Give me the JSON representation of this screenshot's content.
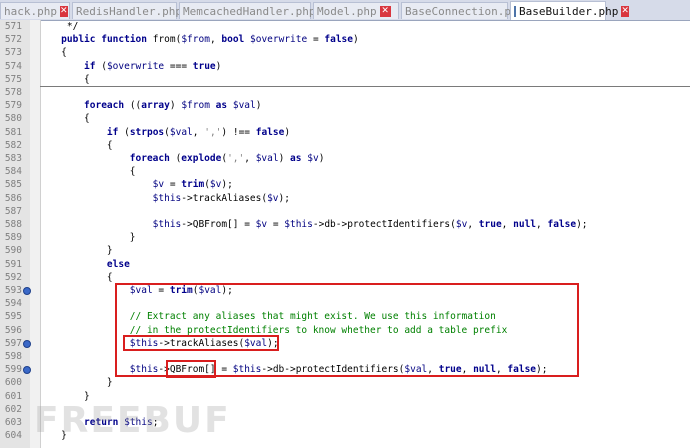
{
  "tabs": [
    {
      "label": "hack.php",
      "active": false
    },
    {
      "label": "RedisHandler.php",
      "active": false
    },
    {
      "label": "MemcachedHandler.php",
      "active": false
    },
    {
      "label": "Model.php",
      "active": false
    },
    {
      "label": "BaseConnection.php",
      "active": false
    },
    {
      "label": "BaseBuilder.php",
      "active": true
    }
  ],
  "lines": [
    {
      "num": "571",
      "code": "    */"
    },
    {
      "num": "572",
      "code": "   public function from($from, bool $overwrite = false)"
    },
    {
      "num": "573",
      "code": "   {"
    },
    {
      "num": "574",
      "code": "       if ($overwrite === true)"
    },
    {
      "num": "575",
      "code": "       {"
    },
    {
      "num": "578",
      "code": ""
    },
    {
      "num": "579",
      "code": "       foreach ((array) $from as $val)"
    },
    {
      "num": "580",
      "code": "       {"
    },
    {
      "num": "581",
      "code": "           if (strpos($val, ',') !== false)"
    },
    {
      "num": "582",
      "code": "           {"
    },
    {
      "num": "583",
      "code": "               foreach (explode(',', $val) as $v)"
    },
    {
      "num": "584",
      "code": "               {"
    },
    {
      "num": "585",
      "code": "                   $v = trim($v);"
    },
    {
      "num": "586",
      "code": "                   $this->trackAliases($v);"
    },
    {
      "num": "587",
      "code": ""
    },
    {
      "num": "588",
      "code": "                   $this->QBFrom[] = $v = $this->db->protectIdentifiers($v, true, null, false);"
    },
    {
      "num": "589",
      "code": "               }"
    },
    {
      "num": "590",
      "code": "           }"
    },
    {
      "num": "591",
      "code": "           else"
    },
    {
      "num": "592",
      "code": "           {"
    },
    {
      "num": "593",
      "code": "               $val = trim($val);"
    },
    {
      "num": "594",
      "code": ""
    },
    {
      "num": "595",
      "code": "               // Extract any aliases that might exist. We use this information"
    },
    {
      "num": "596",
      "code": "               // in the protectIdentifiers to know whether to add a table prefix"
    },
    {
      "num": "597",
      "code": "               $this->trackAliases($val);"
    },
    {
      "num": "598",
      "code": ""
    },
    {
      "num": "599",
      "code": "               $this->QBFrom[] = $this->db->protectIdentifiers($val, true, null, false);"
    },
    {
      "num": "600",
      "code": "           }"
    },
    {
      "num": "601",
      "code": "       }"
    },
    {
      "num": "602",
      "code": ""
    },
    {
      "num": "603",
      "code": "       return $this;"
    },
    {
      "num": "604",
      "code": "   }"
    }
  ],
  "bookmarked_lines": [
    "593",
    "597",
    "599"
  ],
  "watermark": "FREEBUF",
  "colors": {
    "keyword": "#00008b",
    "comment": "#008000",
    "highlight_box": "#d91e1e",
    "bookmark": "#3a68c7"
  }
}
